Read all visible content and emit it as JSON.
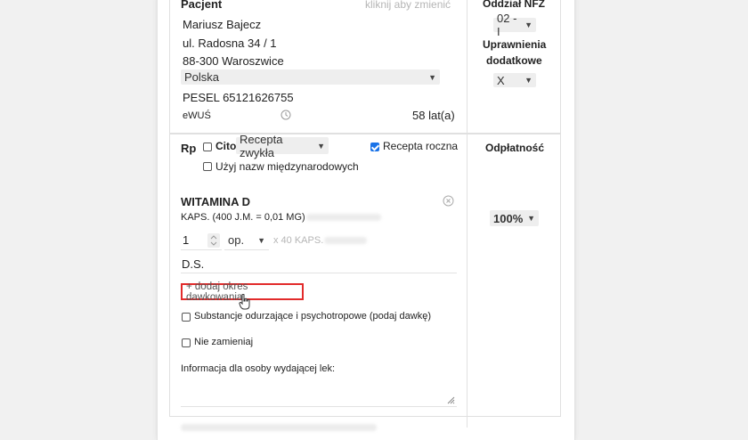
{
  "patient": {
    "heading": "Pacjent",
    "change_link": "kliknij aby zmienić",
    "name": "Mariusz Bajecz",
    "street": "ul. Radosna 34 / 1",
    "city": "88-300 Waroszwice",
    "country": "Polska",
    "pesel_label": "PESEL",
    "pesel": "65121626755",
    "ewus": "eWUŚ",
    "age": "58 lat(a)"
  },
  "nfz": {
    "heading": "Oddział NFZ",
    "value": "02 - I",
    "permissions_heading_1": "Uprawnienia",
    "permissions_heading_2": "dodatkowe",
    "permissions_value": "X"
  },
  "rx": {
    "label": "Rp",
    "cito_label": "Cito",
    "cito_checked": false,
    "type_value": "Recepta zwykła",
    "annual_label": "Recepta roczna",
    "annual_checked": true,
    "intl_names_label": "Użyj nazw międzynarodowych",
    "intl_names_checked": false
  },
  "payment": {
    "heading": "Odpłatność",
    "value": "100%"
  },
  "drug": {
    "name": "WITAMINA D",
    "form": "KAPS. (400 J.M. = 0,01 MG)",
    "quantity": "1",
    "unit": "op.",
    "pack": "x 40 KAPS.",
    "ds_label": "D.S.",
    "add_dosage_label": "+ dodaj okres dawkowania",
    "narcotics_label": "Substancje odurzające i psychotropowe (podaj dawkę)",
    "narcotics_checked": false,
    "no_substitute_label": "Nie zamieniaj",
    "no_substitute_checked": false,
    "dispenser_info_label": "Informacja dla osoby wydającej lek:"
  },
  "colors": {
    "accent": "#1a73e8",
    "highlight_border": "#e22b2b"
  }
}
